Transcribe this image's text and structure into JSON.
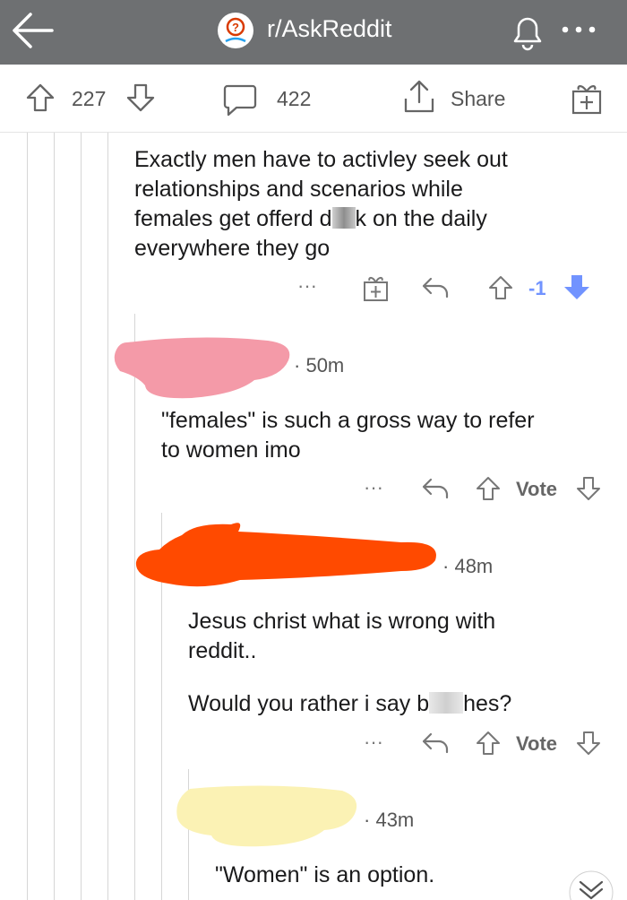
{
  "header": {
    "subreddit": "r/AskReddit",
    "icons": [
      "back-arrow-icon",
      "subreddit-avatar-icon",
      "bell-icon",
      "more-icon"
    ]
  },
  "post_stats": {
    "upvotes": "227",
    "comments": "422",
    "share_label": "Share",
    "icons": [
      "upvote-icon",
      "downvote-icon",
      "comment-icon",
      "share-icon",
      "award-icon"
    ]
  },
  "comments": [
    {
      "lines": [
        "Exactly men have to activley seek out",
        "relationships and scenarios while"
      ],
      "line3_before": "females get offerd d",
      "line3_after": "k on the daily",
      "line4": "everywhere they go",
      "score": "-1",
      "more": "···"
    },
    {
      "time": "50m",
      "lines": [
        "\"females\" is such a gross way to refer",
        "to women imo"
      ],
      "vote_label": "Vote",
      "more": "···"
    },
    {
      "time": "48m",
      "line1": "Jesus christ what is wrong with",
      "line2": "reddit..",
      "line3_before": "Would you rather i say b",
      "line3_after": "hes?",
      "vote_label": "Vote",
      "more": "···"
    },
    {
      "time": "43m",
      "text": "\"Women\" is an option."
    }
  ],
  "colors": {
    "topbar": "#6e7072",
    "downvote_active": "#7193ff",
    "score_negative": "#7193ff",
    "redact_pink": "#f49aa8",
    "redact_orange": "#ff4a00",
    "redact_yellow": "#fbf2b4"
  }
}
